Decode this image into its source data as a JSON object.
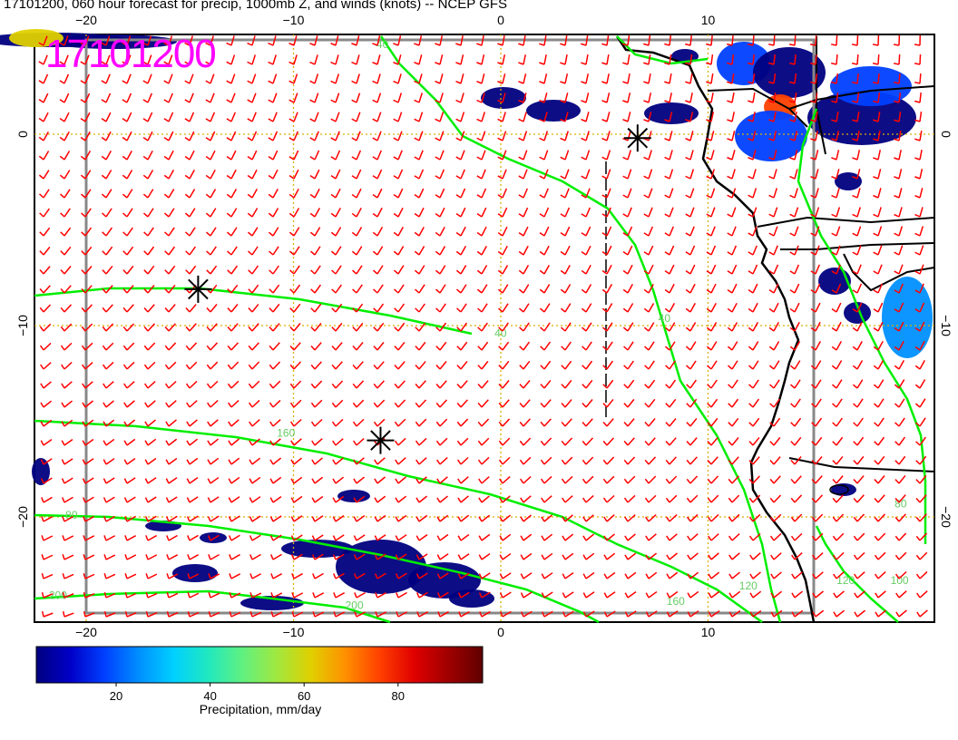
{
  "title": "17101200, 060 hour forecast for precip, 1000mb Z, and winds (knots) -- NCEP GFS",
  "stamp": "17101200",
  "map": {
    "lon_range": [
      -24,
      20
    ],
    "lat_range": [
      -27,
      6
    ],
    "x_ticks": [
      {
        "value": -20,
        "label": "−20"
      },
      {
        "value": -10,
        "label": "−10"
      },
      {
        "value": 0,
        "label": "0"
      },
      {
        "value": 10,
        "label": "10"
      }
    ],
    "y_ticks": [
      {
        "value": 0,
        "label": "0"
      },
      {
        "value": -10,
        "label": "−10"
      },
      {
        "value": -20,
        "label": "−20"
      }
    ],
    "contour_labels": [
      {
        "text": "40",
        "lon": -0.3,
        "lat": -10.6
      },
      {
        "text": "160",
        "lon": -10.8,
        "lat": -15.8
      },
      {
        "text": "80",
        "lon": -21,
        "lat": -20.1
      },
      {
        "text": "200",
        "lon": -21.8,
        "lat": -24.3
      },
      {
        "text": "200",
        "lon": -7.5,
        "lat": -24.8
      },
      {
        "text": "160",
        "lon": 8,
        "lat": -24.6
      },
      {
        "text": "120",
        "lon": 11.5,
        "lat": -23.8
      },
      {
        "text": "40",
        "lon": 7.6,
        "lat": -9.8
      },
      {
        "text": "80",
        "lon": 19,
        "lat": -19.5
      },
      {
        "text": "120",
        "lon": 16.2,
        "lat": -23.5
      },
      {
        "text": "100",
        "lon": 18.8,
        "lat": -23.5
      },
      {
        "text": "40",
        "lon": -6,
        "lat": 4.5
      }
    ],
    "markers": [
      {
        "lon": -14.6,
        "lat": -8.1
      },
      {
        "lon": -5.8,
        "lat": -16.0
      },
      {
        "lon": 6.6,
        "lat": -0.2
      }
    ],
    "colors": {
      "wind": "#ff0000",
      "contour": "#00ee00",
      "grid": "#d8b000",
      "marker": "#000000",
      "coast": "#000000",
      "stamp": "#ff00ff"
    }
  },
  "colorbar": {
    "title": "Precipitation, mm/day",
    "ticks": [
      {
        "value": 20,
        "label": "20"
      },
      {
        "value": 40,
        "label": "40"
      },
      {
        "value": 60,
        "label": "60"
      },
      {
        "value": 80,
        "label": "80"
      }
    ],
    "range": [
      3,
      98
    ],
    "colors": [
      "#000080",
      "#0000c8",
      "#0040ff",
      "#0090ff",
      "#00d0ff",
      "#20e8c0",
      "#60f080",
      "#a0e840",
      "#e0d000",
      "#ff9000",
      "#ff4000",
      "#e00000",
      "#a00000",
      "#600000"
    ]
  }
}
